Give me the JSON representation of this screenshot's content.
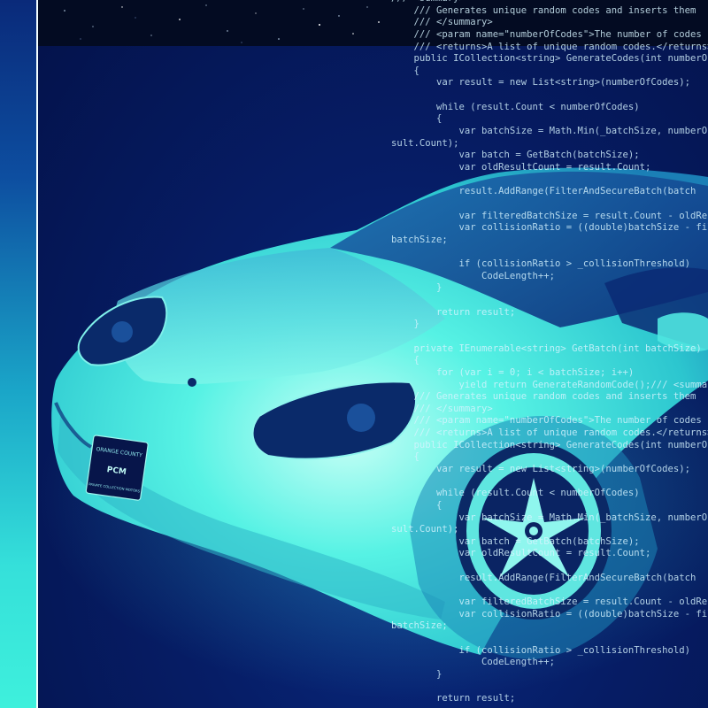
{
  "scene": {
    "subject": "car-with-code-overlay",
    "colors": {
      "background": "#06175a",
      "car_tint": "#3fe6e0",
      "code_text": "#d6f4ff",
      "left_strip_top": "#0a2a7a",
      "left_strip_bottom": "#3ef0dc",
      "starfield": "#030b22"
    }
  },
  "license_plate": {
    "top_text": "ORANGE COUNTY",
    "brand_text": "PCM",
    "bottom_text": "PRIVATE COLLECTION MOTORS"
  },
  "code_lines": [
    "/// <summary>",
    "    /// Generates unique random codes and inserts them",
    "    /// </summary>",
    "    /// <param name=\"numberOfCodes\">The number of codes",
    "    /// <returns>A list of unique random codes.</returns>",
    "    public ICollection<string> GenerateCodes(int numberOfCodes)",
    "    {",
    "        var result = new List<string>(numberOfCodes);",
    "",
    "        while (result.Count < numberOfCodes)",
    "        {",
    "            var batchSize = Math.Min(_batchSize, numberOfCodes - re",
    "sult.Count);",
    "            var batch = GetBatch(batchSize);",
    "            var oldResultCount = result.Count;",
    "",
    "            result.AddRange(FilterAndSecureBatch(batch",
    "",
    "            var filteredBatchSize = result.Count - oldResultCount;",
    "            var collisionRatio = ((double)batchSize - filteredBatchSize) /",
    "batchSize;",
    "",
    "            if (collisionRatio > _collisionThreshold)",
    "                CodeLength++;",
    "        }",
    "",
    "        return result;",
    "    }",
    "",
    "    private IEnumerable<string> GetBatch(int batchSize)",
    "    {",
    "        for (var i = 0; i < batchSize; i++)",
    "            yield return GenerateRandomCode();/// <summary>",
    "    /// Generates unique random codes and inserts them",
    "    /// </summary>",
    "    /// <param name=\"numberOfCodes\">The number of codes",
    "    /// <returns>A list of unique random codes.</returns>",
    "    public ICollection<string> GenerateCodes(int numberOfCodes)",
    "    {",
    "        var result = new List<string>(numberOfCodes);",
    "",
    "        while (result.Count < numberOfCodes)",
    "        {",
    "            var batchSize = Math.Min(_batchSize, numberOfCodes - re",
    "sult.Count);",
    "            var batch = GetBatch(batchSize);",
    "            var oldResultCount = result.Count;",
    "",
    "            result.AddRange(FilterAndSecureBatch(batch",
    "",
    "            var filteredBatchSize = result.Count - oldResultCount;",
    "            var collisionRatio = ((double)batchSize - filteredBatchSize) /",
    "batchSize;",
    "",
    "            if (collisionRatio > _collisionThreshold)",
    "                CodeLength++;",
    "        }",
    "",
    "        return result;"
  ]
}
